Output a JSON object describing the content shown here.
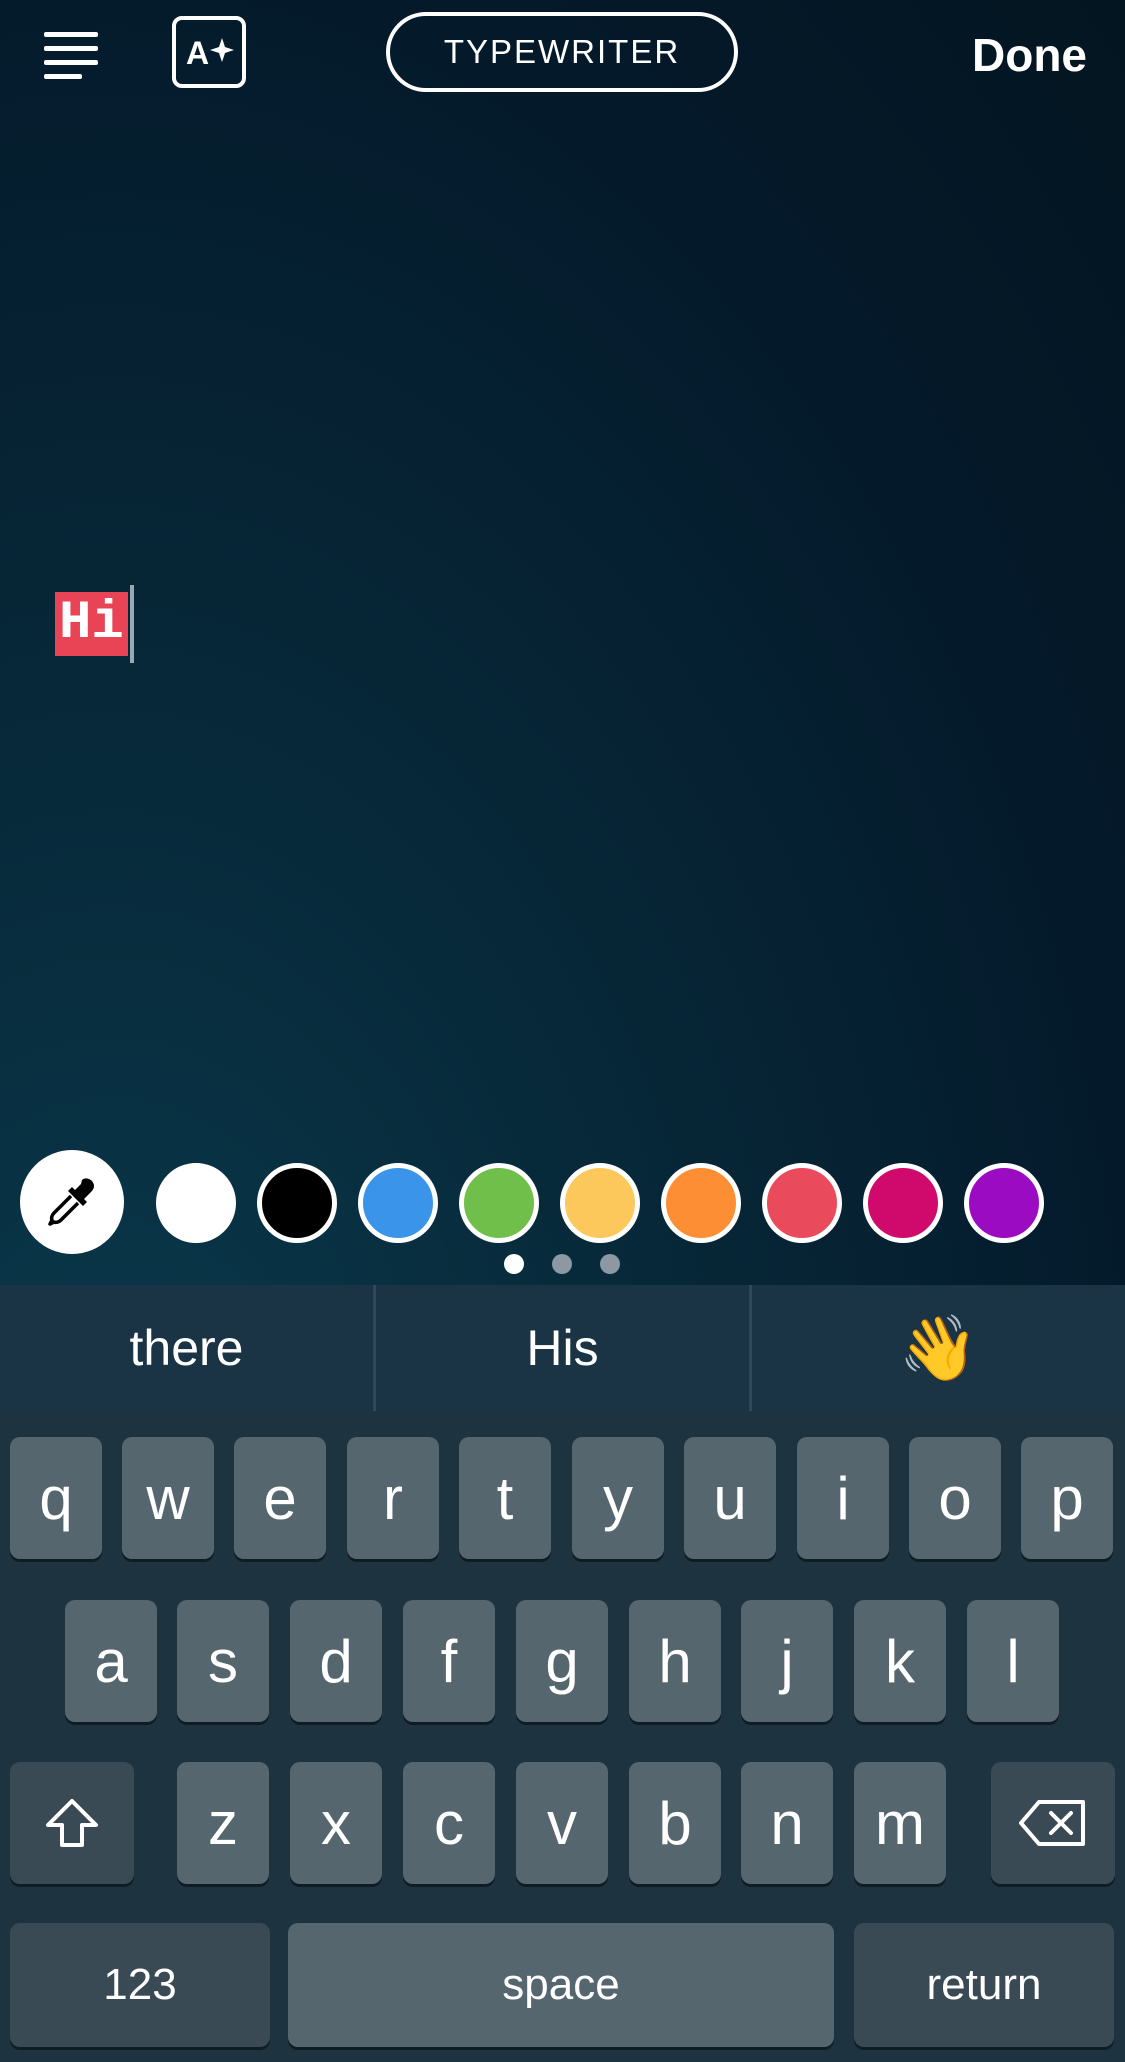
{
  "toolbar": {
    "font_style": "TYPEWRITER",
    "done_label": "Done",
    "align_icon": "text-align-left-icon",
    "effects_icon": "text-effects-sparkle-icon"
  },
  "canvas": {
    "text": "Hi",
    "highlight_color": "#e94356"
  },
  "palette": {
    "eyedropper_icon": "eyedropper-icon",
    "colors": [
      "#ffffff",
      "#000000",
      "#3a95ea",
      "#6fbf4a",
      "#fcc85b",
      "#fd8e34",
      "#ea4b5c",
      "#d00a6d",
      "#9b0bc1"
    ],
    "pages": 3,
    "current_page": 1
  },
  "suggestions": [
    "there",
    "His",
    "👋"
  ],
  "keyboard": {
    "row1": [
      "q",
      "w",
      "e",
      "r",
      "t",
      "y",
      "u",
      "i",
      "o",
      "p"
    ],
    "row2": [
      "a",
      "s",
      "d",
      "f",
      "g",
      "h",
      "j",
      "k",
      "l"
    ],
    "row3": [
      "z",
      "x",
      "c",
      "v",
      "b",
      "n",
      "m"
    ],
    "numbers_label": "123",
    "space_label": "space",
    "return_label": "return",
    "shift_icon": "shift-icon",
    "backspace_icon": "backspace-icon"
  }
}
